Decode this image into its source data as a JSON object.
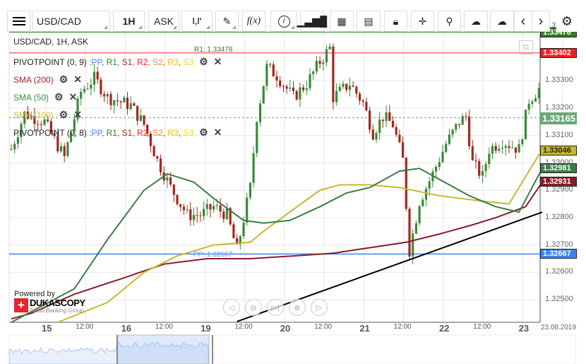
{
  "toolbar": {
    "symbol": "USD/CAD",
    "period": "1H",
    "side": "ASK",
    "fx": "f(x)"
  },
  "chart_title": "USD/CAD, 1H, ASK",
  "legend": {
    "pivot1": "PIVOTPOINT (0, 9)",
    "pivot2": "PIVOTPOINT (0, 8)",
    "levels": [
      "PP",
      "R1",
      "S1",
      "R2",
      "S2",
      "R3",
      "S3"
    ],
    "sma200": "SMA (200)",
    "sma50": "SMA (50)",
    "sma100": "SMA (100)"
  },
  "line_labels": {
    "r1": "R1: 1.33478",
    "pp": "PP: 1.32667"
  },
  "price_tags": {
    "r1": "1.33478",
    "red": "1.33402",
    "last": "1.33165",
    "sma100": "1.33046",
    "sma50": "1.32981",
    "sma200": "1.32931",
    "pp": "1.32667"
  },
  "y_ticks": [
    "1.33500",
    "1.33300",
    "1.33200",
    "1.33100",
    "1.33000",
    "1.32900",
    "1.32800",
    "1.32700",
    "1.32600",
    "1.32500"
  ],
  "x_labels": [
    {
      "t": "15",
      "b": true
    },
    {
      "t": "12:00"
    },
    {
      "t": "16",
      "b": true
    },
    {
      "t": "12:00"
    },
    {
      "t": "19",
      "b": true
    },
    {
      "t": "12:00"
    },
    {
      "t": "20",
      "b": true
    },
    {
      "t": "12:00"
    },
    {
      "t": "21",
      "b": true
    },
    {
      "t": "12:00"
    },
    {
      "t": "22",
      "b": true
    },
    {
      "t": "12:00"
    },
    {
      "t": "23",
      "b": true
    }
  ],
  "date": "23.08.2019",
  "branding": {
    "powered": "Powered by",
    "name": "DUKASCOPY",
    "sub": "Swiss Banking Group"
  },
  "colors": {
    "up": "#3a8a3a",
    "down": "#a0281e",
    "r1": "#2e7d1e",
    "red": "#ff1a1a",
    "pp": "#3b82f6",
    "sma50": "#3a7d44",
    "sma100": "#c8b82a",
    "sma200": "#8b1a2a",
    "last": "#6aa77a"
  },
  "chart_data": {
    "type": "candlestick",
    "price_path": [
      [
        0,
        1.3305
      ],
      [
        4,
        1.3318
      ],
      [
        10,
        1.3315
      ],
      [
        16,
        1.3302
      ],
      [
        21,
        1.3326
      ],
      [
        25,
        1.3331
      ],
      [
        29,
        1.3324
      ],
      [
        36,
        1.3321
      ],
      [
        40,
        1.3314
      ],
      [
        44,
        1.3301
      ],
      [
        48,
        1.3291
      ],
      [
        53,
        1.3281
      ],
      [
        57,
        1.3281
      ],
      [
        61,
        1.3284
      ],
      [
        65,
        1.3281
      ],
      [
        68,
        1.3268
      ],
      [
        72,
        1.3291
      ],
      [
        74,
        1.3317
      ],
      [
        77,
        1.3335
      ],
      [
        80,
        1.3332
      ],
      [
        85,
        1.3324
      ],
      [
        89,
        1.3329
      ],
      [
        93,
        1.3337
      ],
      [
        96,
        1.3342
      ],
      [
        97,
        1.3324
      ],
      [
        102,
        1.3329
      ],
      [
        106,
        1.3322
      ],
      [
        109,
        1.3311
      ],
      [
        112,
        1.3317
      ],
      [
        115,
        1.3314
      ],
      [
        118,
        1.3301
      ],
      [
        120,
        1.3268
      ],
      [
        123,
        1.3286
      ],
      [
        127,
        1.3296
      ],
      [
        131,
        1.3307
      ],
      [
        135,
        1.3315
      ],
      [
        137,
        1.3317
      ],
      [
        139,
        1.33
      ],
      [
        142,
        1.3295
      ],
      [
        144,
        1.3305
      ],
      [
        148,
        1.3308
      ],
      [
        153,
        1.3305
      ],
      [
        156,
        1.3323
      ],
      [
        159,
        1.3327
      ]
    ],
    "sma50": [
      [
        0,
        1.3239
      ],
      [
        19,
        1.3254
      ],
      [
        29,
        1.3272
      ],
      [
        40,
        1.329
      ],
      [
        47,
        1.3296
      ],
      [
        55,
        1.3293
      ],
      [
        61,
        1.3287
      ],
      [
        70,
        1.3279
      ],
      [
        76,
        1.3278
      ],
      [
        84,
        1.3279
      ],
      [
        93,
        1.3284
      ],
      [
        101,
        1.3289
      ],
      [
        108,
        1.3291
      ],
      [
        117,
        1.3297
      ],
      [
        123,
        1.3298
      ],
      [
        129,
        1.3294
      ],
      [
        138,
        1.3288
      ],
      [
        146,
        1.3284
      ],
      [
        153,
        1.3282
      ],
      [
        160,
        1.3298
      ]
    ],
    "sma100": [
      [
        14,
        1.3231
      ],
      [
        29,
        1.3249
      ],
      [
        40,
        1.326
      ],
      [
        50,
        1.3266
      ],
      [
        61,
        1.327
      ],
      [
        72,
        1.3271
      ],
      [
        76,
        1.3275
      ],
      [
        85,
        1.3283
      ],
      [
        93,
        1.329
      ],
      [
        99,
        1.3292
      ],
      [
        108,
        1.3292
      ],
      [
        117,
        1.3291
      ],
      [
        129,
        1.3288
      ],
      [
        142,
        1.3286
      ],
      [
        150,
        1.3285
      ],
      [
        160,
        1.3305
      ]
    ],
    "sma200": [
      [
        0,
        1.3243
      ],
      [
        6,
        1.3245
      ],
      [
        19,
        1.3252
      ],
      [
        34,
        1.3258
      ],
      [
        46,
        1.3263
      ],
      [
        59,
        1.3265
      ],
      [
        72,
        1.3265
      ],
      [
        85,
        1.3266
      ],
      [
        97,
        1.3267
      ],
      [
        108,
        1.3269
      ],
      [
        119,
        1.3271
      ],
      [
        129,
        1.3274
      ],
      [
        138,
        1.3277
      ],
      [
        146,
        1.328
      ],
      [
        155,
        1.3284
      ],
      [
        160,
        1.3293
      ]
    ],
    "trendline": [
      [
        68,
        1.3242
      ],
      [
        160,
        1.3282
      ]
    ],
    "ylim": [
      1.3248,
      1.3359
    ]
  }
}
